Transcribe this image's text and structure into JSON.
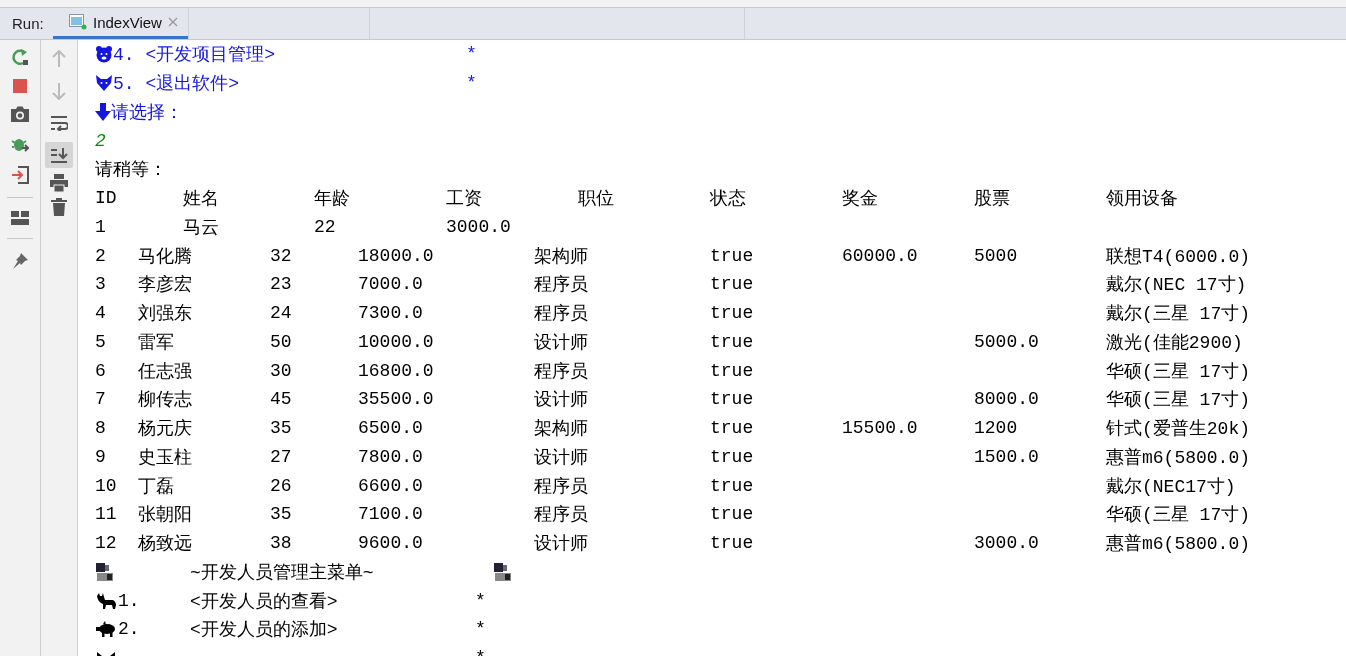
{
  "run_bar": {
    "label": "Run:",
    "tabs": [
      {
        "title": "IndexView",
        "selected": true
      }
    ]
  },
  "toolbar": {
    "soft_wrap": false,
    "scroll_to_end": true
  },
  "console": {
    "lines": [
      {
        "kind": "menu_line",
        "text": "4. <开发项目管理>",
        "mark": "*",
        "color": "#1515e0"
      },
      {
        "kind": "menu_line",
        "text": "5. <退出软件>",
        "mark": "*",
        "color": "#1515e0"
      },
      {
        "kind": "prompt",
        "text": "请选择：",
        "color": "#1515e0"
      },
      {
        "kind": "text",
        "text": "2",
        "color": "#0a8a0a"
      },
      {
        "kind": "text",
        "text": "请稍等：",
        "color": "#000000"
      },
      {
        "kind": "table",
        "columns": [
          "ID",
          "姓名",
          "年龄",
          "工资",
          "职位",
          "状态",
          "奖金",
          "股票",
          "领用设备"
        ],
        "rows": [
          {
            "kind": "short",
            "id": "1",
            "name": "马云",
            "age": "22",
            "salary": "3000.0"
          },
          {
            "kind": "full",
            "id": "2",
            "name": "马化腾",
            "age": "32",
            "salary": "18000.0",
            "position": "架构师",
            "status": "true",
            "bonus": "60000.0",
            "stock": "5000",
            "device": "联想T4(6000.0)"
          },
          {
            "kind": "full",
            "id": "3",
            "name": "李彦宏",
            "age": "23",
            "salary": "7000.0",
            "position": "程序员",
            "status": "true",
            "device": "戴尔(NEC 17寸)"
          },
          {
            "kind": "full",
            "id": "4",
            "name": "刘强东",
            "age": "24",
            "salary": "7300.0",
            "position": "程序员",
            "status": "true",
            "device": "戴尔(三星 17寸)"
          },
          {
            "kind": "full",
            "id": "5",
            "name": "雷军",
            "age": "50",
            "salary": "10000.0",
            "position": "设计师",
            "status": "true",
            "stock": "5000.0",
            "device": "激光(佳能2900)"
          },
          {
            "kind": "full",
            "id": "6",
            "name": "任志强",
            "age": "30",
            "salary": "16800.0",
            "position": "程序员",
            "status": "true",
            "device": "华硕(三星 17寸)"
          },
          {
            "kind": "full",
            "id": "7",
            "name": "柳传志",
            "age": "45",
            "salary": "35500.0",
            "position": "设计师",
            "status": "true",
            "stock": "8000.0",
            "device": "华硕(三星 17寸)"
          },
          {
            "kind": "full",
            "id": "8",
            "name": "杨元庆",
            "age": "35",
            "salary": "6500.0",
            "position": "架构师",
            "status": "true",
            "bonus": "15500.0",
            "stock": "1200",
            "device": "针式(爱普生20k)"
          },
          {
            "kind": "full",
            "id": "9",
            "name": "史玉柱",
            "age": "27",
            "salary": "7800.0",
            "position": "设计师",
            "status": "true",
            "stock": "1500.0",
            "device": "惠普m6(5800.0)"
          },
          {
            "kind": "full",
            "id": "10",
            "name": "丁磊",
            "age": "26",
            "salary": "6600.0",
            "position": "程序员",
            "status": "true",
            "device": "戴尔(NEC17寸)"
          },
          {
            "kind": "full",
            "id": "11",
            "name": "张朝阳",
            "age": "35",
            "salary": "7100.0",
            "position": "程序员",
            "status": "true",
            "device": "华硕(三星 17寸)"
          },
          {
            "kind": "full",
            "id": "12",
            "name": "杨致远",
            "age": "38",
            "salary": "9600.0",
            "position": "设计师",
            "status": "true",
            "stock": "3000.0",
            "device": "惠普m6(5800.0)"
          }
        ]
      },
      {
        "kind": "title",
        "text": "~开发人员管理主菜单~",
        "color": "#000000"
      },
      {
        "kind": "menu_option",
        "number": "1.",
        "label": "<开发人员的查看>",
        "mark": "*",
        "color": "#000000"
      },
      {
        "kind": "menu_option",
        "number": "2.",
        "label": "<开发人员的添加>",
        "mark": "*",
        "color": "#000000"
      },
      {
        "kind": "menu_option",
        "mark": "*"
      }
    ]
  }
}
